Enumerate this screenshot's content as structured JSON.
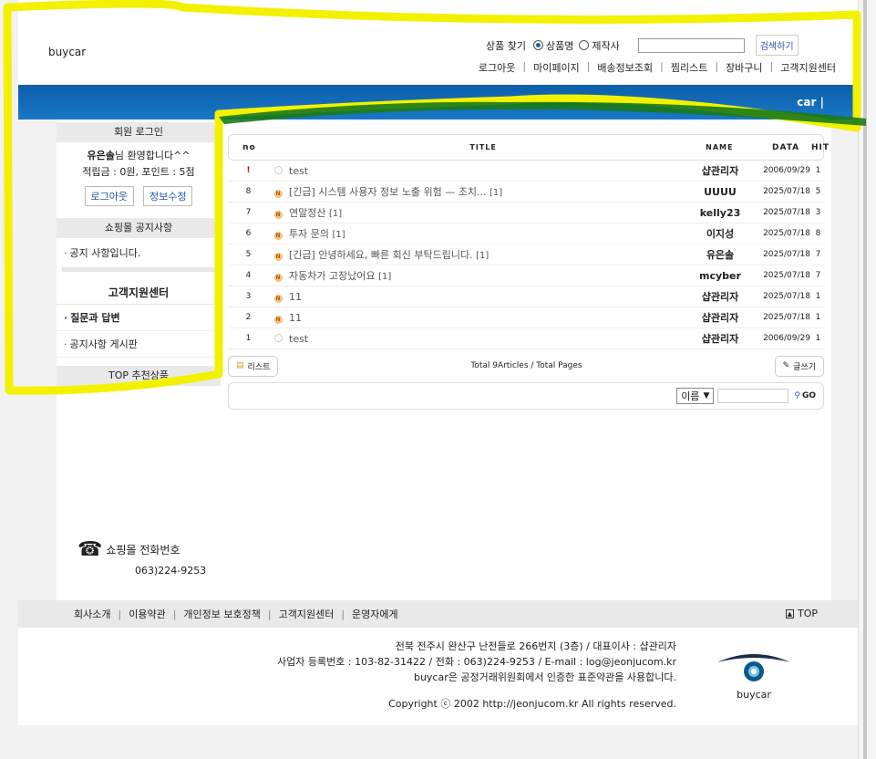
{
  "header": {
    "logo": "buycar",
    "search": {
      "label": "상품 찾기",
      "options": [
        "상품명",
        "제작사"
      ],
      "selected": "상품명",
      "button": "검색하기",
      "placeholder": ""
    },
    "nav": [
      "로그아웃",
      "마이페이지",
      "배송정보조회",
      "찜리스트",
      "장바구니",
      "고객지원센터"
    ],
    "bluebar_text": "car  |"
  },
  "sidebar": {
    "login_title": "회원 로그인",
    "welcome_name": "유은솔",
    "welcome_suffix": "님 환영합니다^^",
    "points": "적립금 : 0원, 포인트 : 5점",
    "logout_button": "로그아웃",
    "edit_button": "정보수정",
    "notice_title": "쇼핑몰 공지사항",
    "notice_item": "공지 사항입니다.",
    "cs_title": "고객지원센터",
    "cs_items": [
      "질문과 답변",
      "공지사항 게시판"
    ],
    "top_title": "TOP 추천상품"
  },
  "board": {
    "columns": [
      "no",
      "TITLE",
      "NAME",
      "DATA",
      "HIT"
    ],
    "rows": [
      {
        "no": "!",
        "icon": "circle",
        "title": "test",
        "count": "",
        "name": "샵관리자",
        "date": "2006/09/29",
        "hit": "1"
      },
      {
        "no": "8",
        "icon": "new",
        "title": "[긴급] 시스템 사용자 정보 노출 위험 — 조치...",
        "count": "[1]",
        "name": "UUUU",
        "date": "2025/07/18",
        "hit": "5"
      },
      {
        "no": "7",
        "icon": "new",
        "title": "연말정산",
        "count": "[1]",
        "name": "kelly23",
        "date": "2025/07/18",
        "hit": "3"
      },
      {
        "no": "6",
        "icon": "new",
        "title": "투자 문의",
        "count": "[1]",
        "name": "이지성",
        "date": "2025/07/18",
        "hit": "8"
      },
      {
        "no": "5",
        "icon": "new",
        "title": "[긴급] 안녕하세요, 빠른 회신 부탁드립니다.",
        "count": "[1]",
        "name": "유은솔",
        "date": "2025/07/18",
        "hit": "7"
      },
      {
        "no": "4",
        "icon": "new",
        "title": "자동차가 고장났어요",
        "count": "[1]",
        "name": "mcyber",
        "date": "2025/07/18",
        "hit": "7"
      },
      {
        "no": "3",
        "icon": "new",
        "title": "11",
        "count": "",
        "name": "샵관리자",
        "date": "2025/07/18",
        "hit": "1"
      },
      {
        "no": "2",
        "icon": "new",
        "title": "11",
        "count": "",
        "name": "샵관리자",
        "date": "2025/07/18",
        "hit": "1"
      },
      {
        "no": "1",
        "icon": "circle",
        "title": "test",
        "count": "",
        "name": "샵관리자",
        "date": "2006/09/29",
        "hit": "1"
      }
    ],
    "list_button": "리스트",
    "total": "Total 9Articles / Total Pages",
    "write_button": "글쓰기",
    "search_select": "이름",
    "go_button": "GO",
    "new_badge": "N"
  },
  "phone": {
    "label": "쇼핑몰 전화번호",
    "number": "063)224-9253"
  },
  "footer": {
    "links": [
      "회사소개",
      "이용약관",
      "개인정보 보호정책",
      "고객지원센터",
      "운영자에게"
    ],
    "top": "TOP",
    "address": "전북 전주시 완산구 난전들로 266번지 (3층) / 대표이사 : 샵관리자",
    "biz": "사업자 등록번호 : 103-82-31422 / 전화 : 063)224-9253 / E-mail : log@jeonjucom.kr",
    "terms": "buycar은 공정거래위원회에서 인증한 표준약관을 사용합니다.",
    "copyright": "Copyright ⓒ 2002 http://jeonjucom.kr All rights reserved.",
    "logo_text": "buycar"
  },
  "colors": {
    "blue_bar": "#0c5ea8",
    "highlight": "#ffff00",
    "link_blue": "#2a56a8"
  }
}
